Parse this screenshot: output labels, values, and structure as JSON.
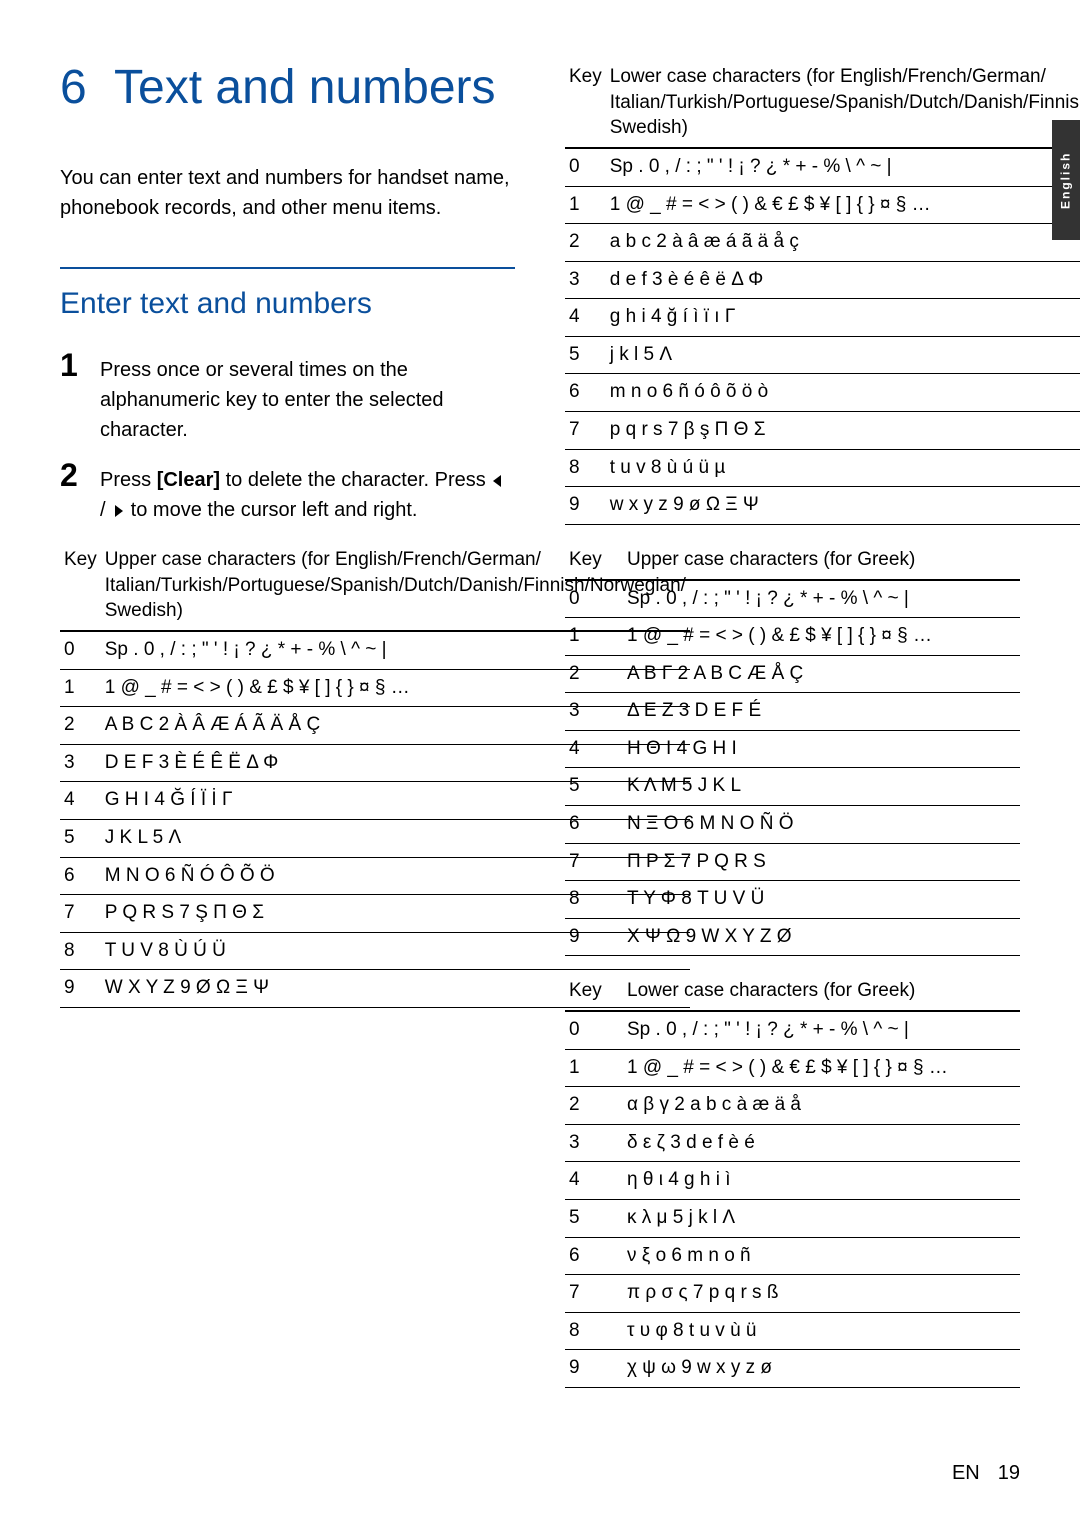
{
  "sideTab": "English",
  "chapter": {
    "number": "6",
    "title": "Text and numbers"
  },
  "intro": "You can enter text and numbers for handset name, phonebook records, and other menu items.",
  "section": {
    "title": "Enter text and numbers"
  },
  "steps": {
    "s1": {
      "num": "1",
      "text": "Press once or several times on the alphanumeric key to enter the selected character."
    },
    "s2": {
      "num": "2",
      "t1": "Press ",
      "clear": "[Clear]",
      "t2": " to delete the character. Press ",
      "t3": " / ",
      "t4": " to move the cursor left and right."
    }
  },
  "tables": {
    "keyLabel": "Key",
    "upper_euro": {
      "header": "Upper case characters (for English/French/German/ Italian/Turkish/Portuguese/Spanish/Dutch/Danish/Finnish/Norwegian/ Swedish)",
      "rows": [
        {
          "k": "0",
          "v": "Sp . 0 , / : ; \" ' ! ¡ ? ¿ * + - % \\ ^ ~ |"
        },
        {
          "k": "1",
          "v": "1 @ _ # = < > ( ) & £ $ ¥ [ ] { } ¤ § …"
        },
        {
          "k": "2",
          "v": "A B C 2 À Â Æ Á Ã Ä Å Ç"
        },
        {
          "k": "3",
          "v": "D E F 3 È É Ê Ë Δ Φ"
        },
        {
          "k": "4",
          "v": "G H I 4 Ğ Í Ï İ Γ"
        },
        {
          "k": "5",
          "v": "J K L 5 Λ"
        },
        {
          "k": "6",
          "v": "M N O 6 Ñ Ó Ô Õ Ö"
        },
        {
          "k": "7",
          "v": "P Q R S 7 Ş Π Θ Σ"
        },
        {
          "k": "8",
          "v": "T U V 8 Ù Ú Ü"
        },
        {
          "k": "9",
          "v": "W X Y Z 9 Ø Ω Ξ Ψ"
        }
      ]
    },
    "lower_euro": {
      "header": "Lower case characters (for English/French/German/ Italian/Turkish/Portuguese/Spanish/Dutch/Danish/Finnish/Norwegian/ Swedish)",
      "rows": [
        {
          "k": "0",
          "v": "Sp . 0 , / : ; \" ' ! ¡ ? ¿ * + - % \\ ^ ~ |"
        },
        {
          "k": "1",
          "v": "1 @ _ # = < > ( ) & € £ $ ¥ [ ] { } ¤ § …"
        },
        {
          "k": "2",
          "v": "a b c 2 à â æ á ã ä å ç"
        },
        {
          "k": "3",
          "v": "d e f 3 è é ê ë Δ Φ"
        },
        {
          "k": "4",
          "v": "g h i 4 ğ í ì ï ı Γ"
        },
        {
          "k": "5",
          "v": "j k l 5 Λ"
        },
        {
          "k": "6",
          "v": "m n o 6 ñ ó ô õ ö ò"
        },
        {
          "k": "7",
          "v": "p q r s 7 β ş Π Θ Σ"
        },
        {
          "k": "8",
          "v": "t u v 8 ù ú ü µ"
        },
        {
          "k": "9",
          "v": "w x y z 9 ø Ω Ξ Ψ"
        }
      ]
    },
    "upper_greek": {
      "header": "Upper case characters (for Greek)",
      "rows": [
        {
          "k": "0",
          "v": "Sp . 0 , / : ; \" ' ! ¡ ? ¿ * + - % \\ ^ ~ |"
        },
        {
          "k": "1",
          "v": "1 @ _ # = < > ( ) & £ $ ¥ [ ] { } ¤ § …"
        },
        {
          "k": "2",
          "v": "Α Β Γ 2 A B C Æ Å Ç"
        },
        {
          "k": "3",
          "v": "Δ Ε Ζ 3 D E F É"
        },
        {
          "k": "4",
          "v": "Η Θ Ι 4 G H I"
        },
        {
          "k": "5",
          "v": "Κ Λ Μ 5 J K L"
        },
        {
          "k": "6",
          "v": "Ν Ξ Ο 6 M N O Ñ Ö"
        },
        {
          "k": "7",
          "v": "Π Ρ Σ 7 P Q R S"
        },
        {
          "k": "8",
          "v": "Τ Υ Φ 8 T U V Ü"
        },
        {
          "k": "9",
          "v": "Χ Ψ Ω 9 W X Y Z Ø"
        }
      ]
    },
    "lower_greek": {
      "header": "Lower case characters (for Greek)",
      "rows": [
        {
          "k": "0",
          "v": "Sp . 0 , / : ; \" ' ! ¡ ? ¿ * + - % \\ ^ ~ |"
        },
        {
          "k": "1",
          "v": "1 @ _ # = < > ( ) & € £ $ ¥ [ ] { } ¤ § …"
        },
        {
          "k": "2",
          "v": "α β γ 2 a b c à æ ä å"
        },
        {
          "k": "3",
          "v": "δ ε ζ 3 d e f è é"
        },
        {
          "k": "4",
          "v": "η θ ι 4 g h i ì"
        },
        {
          "k": "5",
          "v": "κ λ μ 5 j k l Λ"
        },
        {
          "k": "6",
          "v": "ν ξ ο 6 m n o ñ"
        },
        {
          "k": "7",
          "v": "π ρ σ ς 7 p q r s ß"
        },
        {
          "k": "8",
          "v": "τ υ φ 8 t u v ù ü"
        },
        {
          "k": "9",
          "v": "χ ψ ω 9 w x y z ø"
        }
      ]
    }
  },
  "footer": {
    "label": "EN",
    "page": "19"
  }
}
